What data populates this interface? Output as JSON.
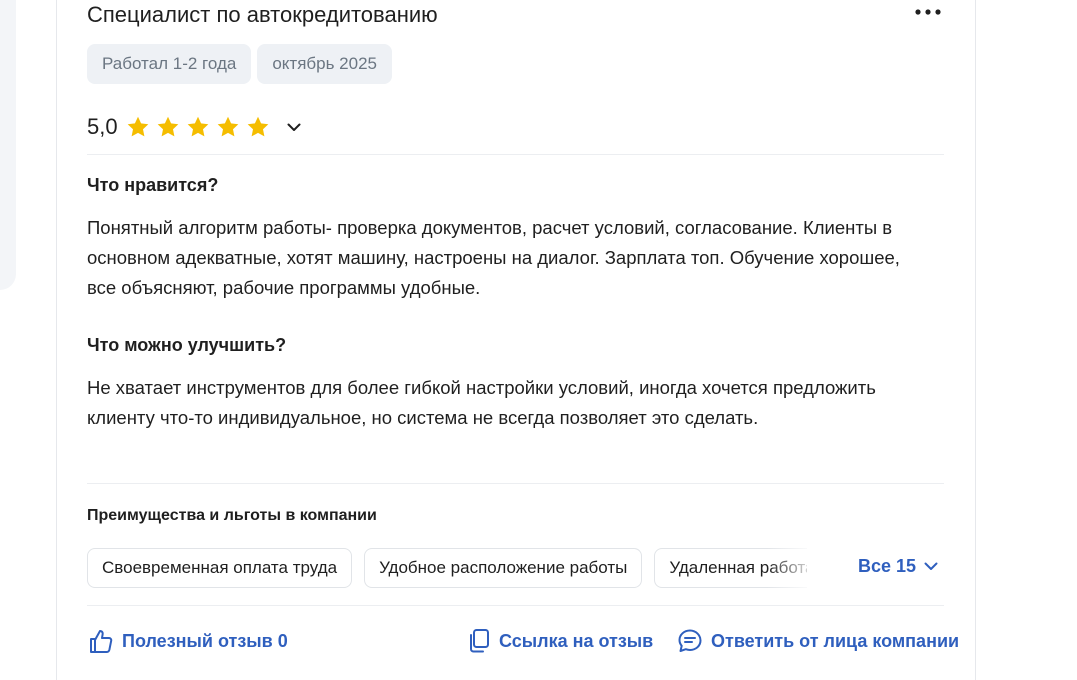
{
  "review": {
    "title": "Специалист по автокредитованию",
    "more_icon": "more-horizontal-icon",
    "meta": [
      "Работал 1-2 года",
      "октябрь 2025"
    ],
    "rating": {
      "value": "5,0",
      "stars": 5,
      "max": 5,
      "star_color": "#f5bd00"
    },
    "likes_heading": "Что нравится?",
    "likes_text": "Понятный алгоритм работы- проверка документов, расчет условий, согласование. Клиенты в основном адекватные, хотят машину, настроены на диалог. Зарплата топ. Обучение хорошее, все объясняют, рабочие программы удобные.",
    "improve_heading": "Что можно улучшить?",
    "improve_text": "Не хватает инструментов для более гибкой настройки условий, иногда хочется предложить клиенту что-то индивидуальное, но система не всегда позволяет это сделать."
  },
  "perks": {
    "heading": "Преимущества и льготы в компании",
    "items": [
      "Своевременная оплата труда",
      "Удобное расположение работы",
      "Удаленная работа"
    ],
    "all_label": "Все 15"
  },
  "actions": {
    "helpful": "Полезный отзыв 0",
    "link": "Ссылка на отзыв",
    "reply": "Ответить от лица компании"
  },
  "colors": {
    "accent": "#2f5fbe",
    "chip_bg": "#eef1f5",
    "star": "#f5bd00"
  }
}
